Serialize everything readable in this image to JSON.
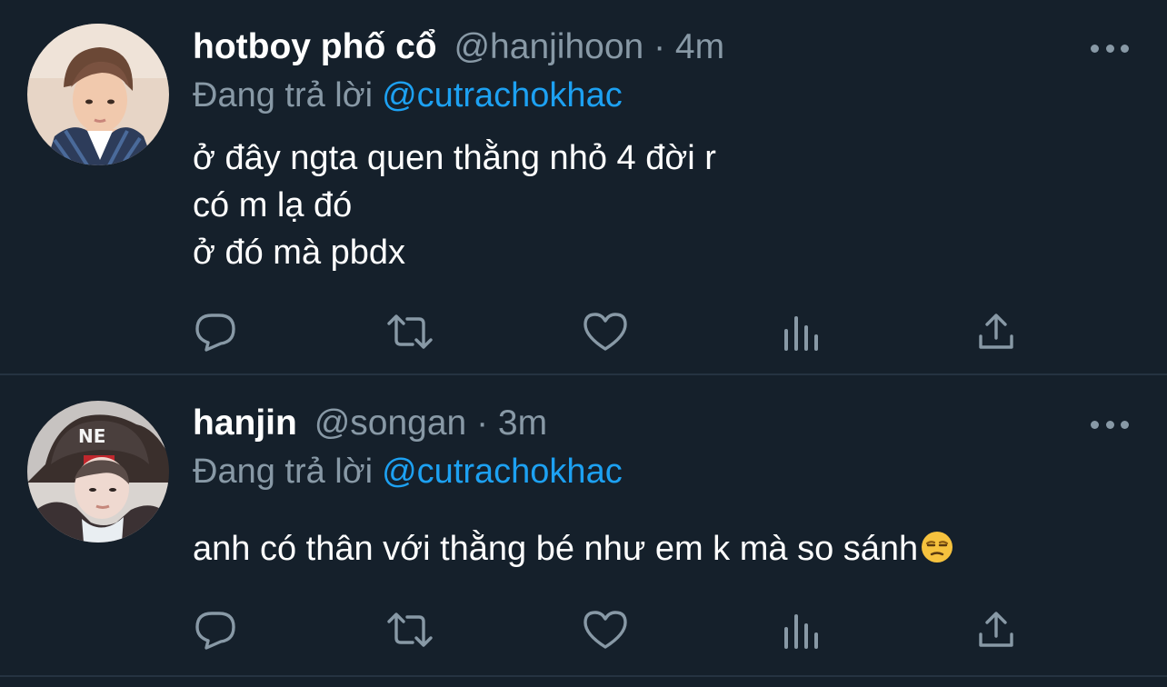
{
  "tweets": [
    {
      "display_name": "hotboy phố cổ",
      "handle": "@hanjihoon",
      "separator": "·",
      "time": "4m",
      "reply_prefix": "Đang trả lời",
      "reply_to": "@cutrachokhac",
      "lines": [
        "ở đây ngta quen thằng nhỏ 4 đời r",
        "có m lạ đó",
        "ở đó mà pbdx"
      ],
      "avatar": "avatar-photo"
    },
    {
      "display_name": "hanjin",
      "handle": "@songan",
      "separator": "·",
      "time": "3m",
      "reply_prefix": "Đang trả lời",
      "reply_to": "@cutrachokhac",
      "lines": [
        "anh có thân với thằng bé như em k mà so sánh"
      ],
      "emoji": "unamused-face",
      "avatar": "avatar-photo"
    }
  ],
  "icons": {
    "reply": "comment-bubble-icon",
    "retweet": "retweet-icon",
    "like": "heart-icon",
    "views": "analytics-icon",
    "share": "share-icon",
    "more": "more-options-icon"
  },
  "colors": {
    "background": "#15202b",
    "secondary_text": "#8899a6",
    "link": "#1da1f2",
    "divider": "#253341"
  }
}
